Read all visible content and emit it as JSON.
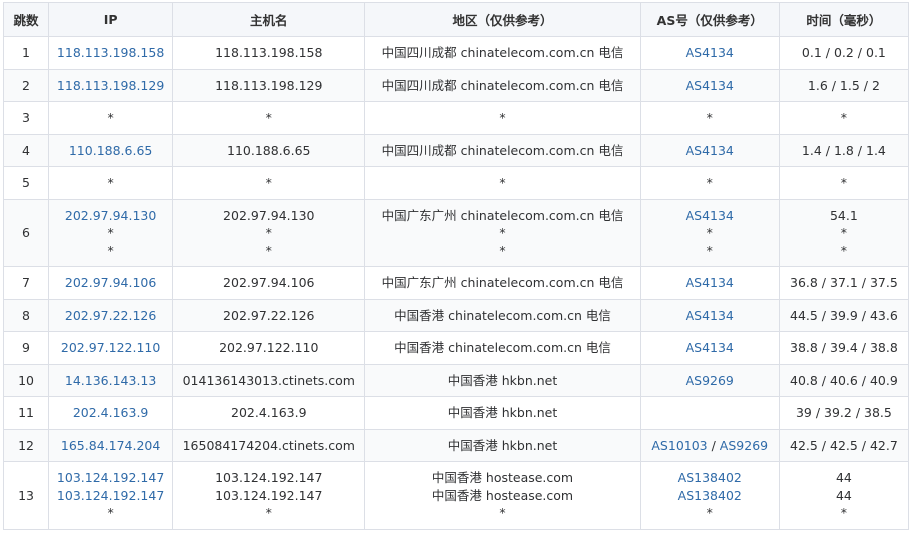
{
  "headers": [
    "跳数",
    "IP",
    "主机名",
    "地区（仅供参考）",
    "AS号（仅供参考）",
    "时间（毫秒）"
  ],
  "rows": [
    {
      "hop": "1",
      "ip": [
        "118.113.198.158"
      ],
      "host": [
        "118.113.198.158"
      ],
      "geo": [
        "中国四川成都 chinatelecom.com.cn 电信"
      ],
      "as": [
        [
          "AS4134"
        ]
      ],
      "time": [
        "0.1 / 0.2 / 0.1"
      ]
    },
    {
      "hop": "2",
      "ip": [
        "118.113.198.129"
      ],
      "host": [
        "118.113.198.129"
      ],
      "geo": [
        "中国四川成都 chinatelecom.com.cn 电信"
      ],
      "as": [
        [
          "AS4134"
        ]
      ],
      "time": [
        "1.6 / 1.5 / 2"
      ]
    },
    {
      "hop": "3",
      "ip": [
        "*"
      ],
      "host": [
        "*"
      ],
      "geo": [
        "*"
      ],
      "as": [
        [
          "*"
        ]
      ],
      "time": [
        "*"
      ]
    },
    {
      "hop": "4",
      "ip": [
        "110.188.6.65"
      ],
      "host": [
        "110.188.6.65"
      ],
      "geo": [
        "中国四川成都 chinatelecom.com.cn 电信"
      ],
      "as": [
        [
          "AS4134"
        ]
      ],
      "time": [
        "1.4 / 1.8 / 1.4"
      ]
    },
    {
      "hop": "5",
      "ip": [
        "*"
      ],
      "host": [
        "*"
      ],
      "geo": [
        "*"
      ],
      "as": [
        [
          "*"
        ]
      ],
      "time": [
        "*"
      ]
    },
    {
      "hop": "6",
      "ip": [
        "202.97.94.130",
        "*",
        "*"
      ],
      "host": [
        "202.97.94.130",
        "*",
        "*"
      ],
      "geo": [
        "中国广东广州 chinatelecom.com.cn 电信",
        "*",
        "*"
      ],
      "as": [
        [
          "AS4134"
        ],
        [
          "*"
        ],
        [
          "*"
        ]
      ],
      "time": [
        "54.1",
        "*",
        "*"
      ]
    },
    {
      "hop": "7",
      "ip": [
        "202.97.94.106"
      ],
      "host": [
        "202.97.94.106"
      ],
      "geo": [
        "中国广东广州 chinatelecom.com.cn 电信"
      ],
      "as": [
        [
          "AS4134"
        ]
      ],
      "time": [
        "36.8 / 37.1 / 37.5"
      ]
    },
    {
      "hop": "8",
      "ip": [
        "202.97.22.126"
      ],
      "host": [
        "202.97.22.126"
      ],
      "geo": [
        "中国香港 chinatelecom.com.cn 电信"
      ],
      "as": [
        [
          "AS4134"
        ]
      ],
      "time": [
        "44.5 / 39.9 / 43.6"
      ]
    },
    {
      "hop": "9",
      "ip": [
        "202.97.122.110"
      ],
      "host": [
        "202.97.122.110"
      ],
      "geo": [
        "中国香港 chinatelecom.com.cn 电信"
      ],
      "as": [
        [
          "AS4134"
        ]
      ],
      "time": [
        "38.8 / 39.4 / 38.8"
      ]
    },
    {
      "hop": "10",
      "ip": [
        "14.136.143.13"
      ],
      "host": [
        "014136143013.ctinets.com"
      ],
      "geo": [
        "中国香港 hkbn.net"
      ],
      "as": [
        [
          "AS9269"
        ]
      ],
      "time": [
        "40.8 / 40.6 / 40.9"
      ]
    },
    {
      "hop": "11",
      "ip": [
        "202.4.163.9"
      ],
      "host": [
        "202.4.163.9"
      ],
      "geo": [
        "中国香港 hkbn.net"
      ],
      "as": [
        []
      ],
      "time": [
        "39 / 39.2 / 38.5"
      ]
    },
    {
      "hop": "12",
      "ip": [
        "165.84.174.204"
      ],
      "host": [
        "165084174204.ctinets.com"
      ],
      "geo": [
        "中国香港 hkbn.net"
      ],
      "as": [
        [
          "AS10103",
          "AS9269"
        ]
      ],
      "time": [
        "42.5 / 42.5 / 42.7"
      ]
    },
    {
      "hop": "13",
      "ip": [
        "103.124.192.147",
        "103.124.192.147",
        "*"
      ],
      "host": [
        "103.124.192.147",
        "103.124.192.147",
        "*"
      ],
      "geo": [
        "中国香港 hostease.com",
        "中国香港 hostease.com",
        "*"
      ],
      "as": [
        [
          "AS138402"
        ],
        [
          "AS138402"
        ],
        [
          "*"
        ]
      ],
      "time": [
        "44",
        "44",
        "*"
      ]
    }
  ],
  "colors": {
    "link": "#2f6aa8",
    "border": "#dcdfe6",
    "header_bg": "#f5f7fa",
    "stripe_bg": "#f9fafb"
  }
}
